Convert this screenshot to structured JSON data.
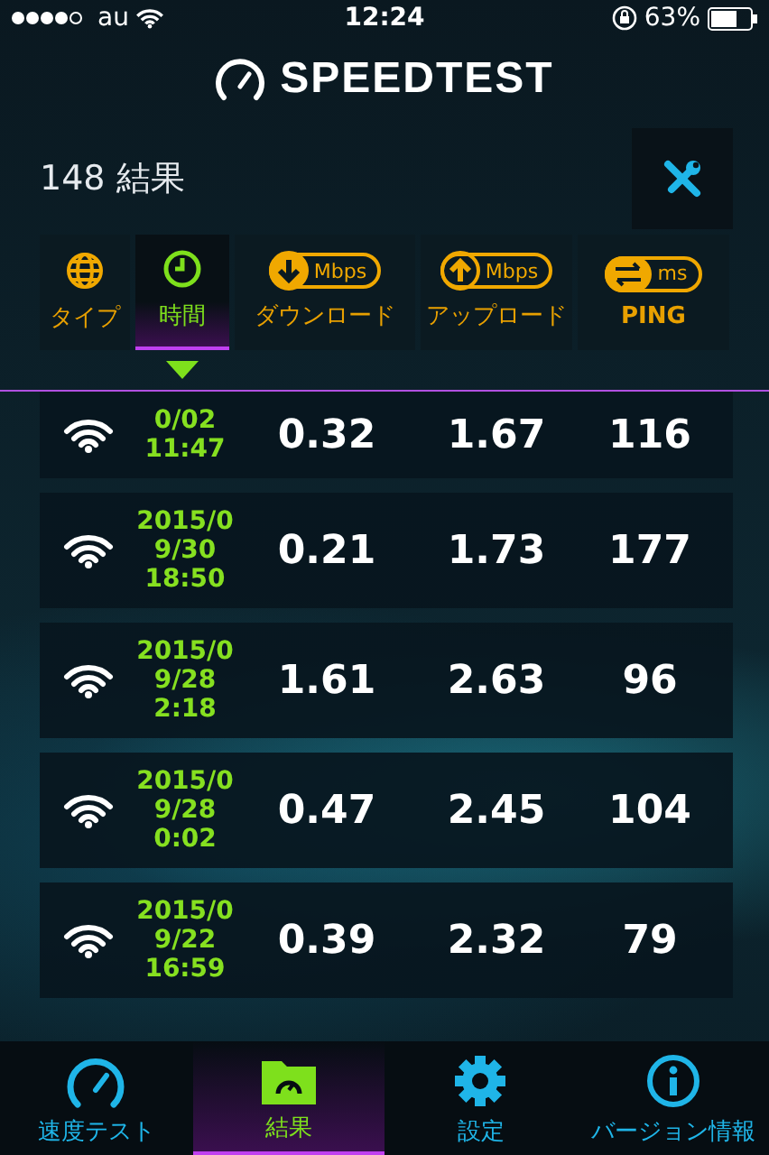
{
  "status_bar": {
    "carrier": "au",
    "time": "12:24",
    "battery": "63%"
  },
  "app_title": "SPEEDTEST",
  "result_count": "148 結果",
  "columns": [
    {
      "kind": "type",
      "label": "タイプ",
      "selected": false
    },
    {
      "kind": "time",
      "label": "時間",
      "selected": true
    },
    {
      "kind": "down",
      "label": "ダウンロード",
      "unit": "Mbps",
      "selected": false
    },
    {
      "kind": "up",
      "label": "アップロード",
      "unit": "Mbps",
      "selected": false
    },
    {
      "kind": "ping",
      "label": "PING",
      "unit": "ms",
      "selected": false
    }
  ],
  "rows": [
    {
      "date_lines": [
        "0/02",
        "11:47"
      ],
      "download": "0.32",
      "upload": "1.67",
      "ping": "116"
    },
    {
      "date_lines": [
        "2015/0",
        "9/30",
        "18:50"
      ],
      "download": "0.21",
      "upload": "1.73",
      "ping": "177"
    },
    {
      "date_lines": [
        "2015/0",
        "9/28",
        "2:18"
      ],
      "download": "1.61",
      "upload": "2.63",
      "ping": "96"
    },
    {
      "date_lines": [
        "2015/0",
        "9/28",
        "0:02"
      ],
      "download": "0.47",
      "upload": "2.45",
      "ping": "104"
    },
    {
      "date_lines": [
        "2015/0",
        "9/22",
        "16:59"
      ],
      "download": "0.39",
      "upload": "2.32",
      "ping": "79"
    }
  ],
  "tabs": [
    {
      "kind": "speedtest",
      "label": "速度テスト",
      "selected": false
    },
    {
      "kind": "results",
      "label": "結果",
      "selected": true
    },
    {
      "kind": "settings",
      "label": "設定",
      "selected": false
    },
    {
      "kind": "info",
      "label": "バージョン情報",
      "selected": false
    }
  ]
}
